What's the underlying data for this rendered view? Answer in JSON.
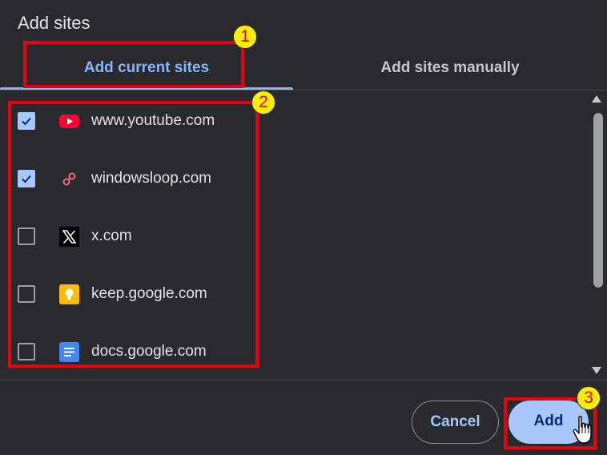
{
  "dialog": {
    "title": "Add sites"
  },
  "tabs": [
    {
      "label": "Add current sites",
      "selected": true
    },
    {
      "label": "Add sites manually",
      "selected": false
    }
  ],
  "sites": [
    {
      "name": "www.youtube.com",
      "checked": true,
      "icon": "youtube-icon"
    },
    {
      "name": "windowsloop.com",
      "checked": true,
      "icon": "windowsloop-icon"
    },
    {
      "name": "x.com",
      "checked": false,
      "icon": "x-logo-icon"
    },
    {
      "name": "keep.google.com",
      "checked": false,
      "icon": "google-keep-icon"
    },
    {
      "name": "docs.google.com",
      "checked": false,
      "icon": "google-docs-icon"
    }
  ],
  "buttons": {
    "cancel": "Cancel",
    "add": "Add"
  },
  "annotations": [
    "1",
    "2",
    "3"
  ],
  "colors": {
    "background": "#292a2d",
    "accent": "#8ab4f8",
    "primary_button": "#a8c7fa",
    "annotation": "#e60012",
    "badge": "#ffee00"
  }
}
